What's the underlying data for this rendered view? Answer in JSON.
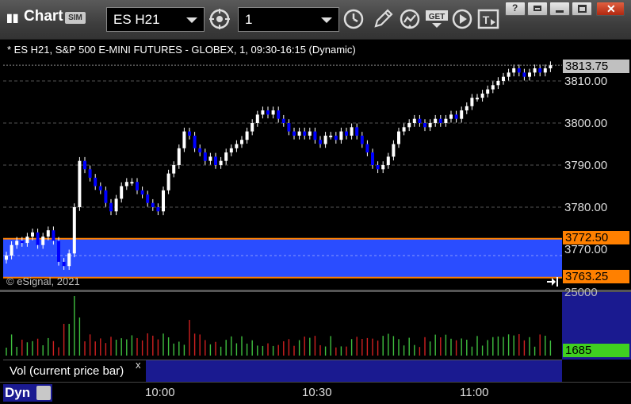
{
  "titlebar": {
    "app_title": "Chart",
    "sim_badge": "SIM",
    "symbol_value": "ES H21",
    "interval_value": "1"
  },
  "chart": {
    "caption": "* ES H21, S&P 500 E-MINI FUTURES - GLOBEX, 1, 09:30-16:15 (Dynamic)",
    "copyright": "© eSignal, 2021",
    "price_ticks": [
      "3810.00",
      "3800.00",
      "3790.00",
      "3780.00",
      "3770.00"
    ],
    "last_price": "3813.75",
    "band_high": "3772.50",
    "band_low": "3763.25",
    "colors": {
      "up": "#ffffff",
      "down": "#0000ff",
      "band": "#2a4dff",
      "band_line": "#ff8000",
      "last_price_bg": "#c0c0c0",
      "vol_up": "#3fbf3f",
      "vol_down": "#d02020",
      "vol_label_bg": "#40d020"
    }
  },
  "volume": {
    "axis_top": "25000",
    "current": "1685",
    "tab_label": "Vol (current price bar)",
    "close_label": "x"
  },
  "time_axis": [
    "10:00",
    "10:30",
    "11:00"
  ],
  "footer": {
    "mode_label": "Dyn"
  },
  "icons": {
    "crosshair": "crosshair-icon",
    "clock": "clock-icon",
    "pencil": "pencil-icon",
    "study": "study-icon",
    "get": "get-data-icon",
    "play": "play-icon",
    "text": "text-tool-icon"
  },
  "chart_data": {
    "type": "candlestick",
    "title": "* ES H21, S&P 500 E-MINI FUTURES - GLOBEX, 1, 09:30-16:15 (Dynamic)",
    "x_labels": [
      "10:00",
      "10:30",
      "11:00"
    ],
    "ylim": [
      3763.25,
      3816
    ],
    "price_band": [
      3763.25,
      3772.5
    ],
    "last": 3813.75,
    "closes": [
      3768.5,
      3771,
      3772,
      3771.5,
      3773,
      3774,
      3771,
      3773,
      3774.5,
      3772,
      3767,
      3766,
      3769,
      3780,
      3791,
      3789,
      3787,
      3785,
      3784,
      3781,
      3779,
      3782,
      3785,
      3786,
      3786,
      3784,
      3783,
      3781,
      3780,
      3779,
      3784,
      3788,
      3790,
      3794,
      3798,
      3797,
      3794,
      3793,
      3791,
      3792,
      3790,
      3791,
      3793,
      3794,
      3795,
      3796,
      3798,
      3800,
      3802,
      3803,
      3802,
      3803,
      3801,
      3800,
      3798,
      3797,
      3798,
      3797,
      3798,
      3796,
      3795,
      3797,
      3797,
      3796,
      3798,
      3797,
      3799,
      3797,
      3795,
      3793,
      3790,
      3789,
      3790,
      3792,
      3795,
      3798,
      3799,
      3800,
      3801,
      3800,
      3799,
      3800,
      3801,
      3800,
      3801,
      3802,
      3801,
      3803,
      3804,
      3806,
      3806,
      3807,
      3808,
      3809,
      3810,
      3811,
      3812,
      3813,
      3812,
      3811,
      3812,
      3813,
      3812,
      3813,
      3813.75
    ]
  }
}
